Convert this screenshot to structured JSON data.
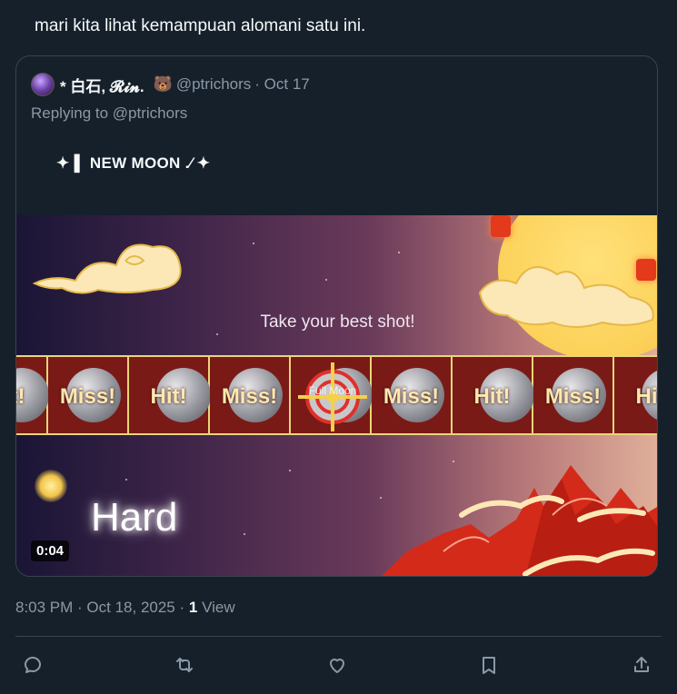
{
  "post": {
    "text": "mari kita lihat kemampuan alomani satu ini."
  },
  "quote": {
    "author_name": "* 白石, 𝓡𝓲𝓷.",
    "emoji": "🐻",
    "handle": "@ptrichors",
    "date": "· Oct 17",
    "replying_prefix": "Replying to",
    "replying_handle": "@ptrichors",
    "body": "✦ ▌ NEW MOON .⁄ ✦"
  },
  "media": {
    "prompt_text": "Take your best shot!",
    "difficulty": "Hard",
    "timer": "0:04",
    "target_label": "Full Moon",
    "cells": [
      "Hit!",
      "Miss!",
      "Hit!",
      "Miss!",
      "",
      "Miss!",
      "Hit!",
      "Miss!",
      "Hit!"
    ]
  },
  "meta": {
    "time": "8:03 PM · Oct 18, 2025 ·",
    "views_count": "1",
    "views_label": "View"
  },
  "actions": {
    "icons": [
      "reply-icon",
      "repost-icon",
      "like-icon",
      "bookmark-icon",
      "share-icon"
    ]
  },
  "colors": {
    "background": "#15202b",
    "text_primary": "#f7f9f9",
    "text_secondary": "#8b98a5",
    "border": "#38444d",
    "strip_red": "#6b1616",
    "strip_gold": "#e9d67a"
  }
}
